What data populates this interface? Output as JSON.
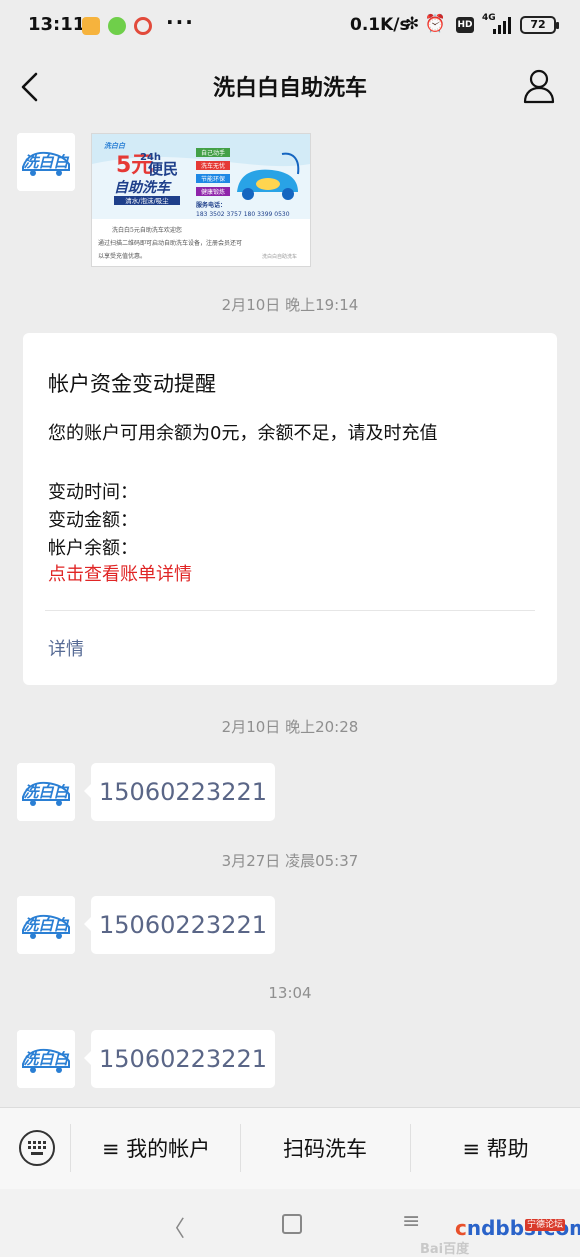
{
  "status_bar": {
    "time": "13:11",
    "dots": "···",
    "net_speed": "0.1K/s",
    "hd": "HD",
    "signal": "4G",
    "battery": "72"
  },
  "nav": {
    "title": "洗白白自助洗车"
  },
  "chat": {
    "messages": [
      {
        "timestamp": "2月10日 晚上19:14"
      },
      {
        "timestamp": "2月10日 晚上20:28",
        "text": "15060223221"
      },
      {
        "timestamp": "3月27日 凌晨05:37",
        "text": "15060223221"
      },
      {
        "timestamp": "13:04",
        "text": "15060223221"
      }
    ],
    "image_banner": {
      "price": "5元",
      "hours": "24h",
      "headline1": "便民",
      "headline2": "自助洗车",
      "services": [
        "清水/泡沫/吸尘"
      ],
      "tags": [
        "自己动手",
        "洗车无忧",
        "节能环保",
        "健康锻炼"
      ],
      "phone_label": "服务电话：",
      "phones": "183 3502 3757    180 3399 0530",
      "caption1": "洗白白5元自助洗车欢迎您",
      "caption2": "通过扫描二维码即可启动自助洗车设备，注册会员还可",
      "caption3": "以享受充值优惠。",
      "credit": "洗白白自助洗车"
    },
    "notice_card": {
      "title": "帐户资金变动提醒",
      "body": "您的账户可用余额为0元，余额不足，请及时充值",
      "line1": "变动时间：",
      "line2": "变动金额：",
      "line3": "帐户余额：",
      "link": "点击查看账单详情",
      "detail": "详情"
    }
  },
  "menu": {
    "item1": "≡ 我的帐户",
    "item2": "扫码洗车",
    "item3": "≡ 帮助"
  },
  "watermark": {
    "site": "ndbbs.com",
    "site_prefix": "c",
    "badge": "宁德论坛",
    "baidu": "Bai百度"
  },
  "colors": {
    "background": "#ededed",
    "link_red": "#e02525",
    "detail_blue": "#576b95",
    "number_text": "#5a6687"
  }
}
